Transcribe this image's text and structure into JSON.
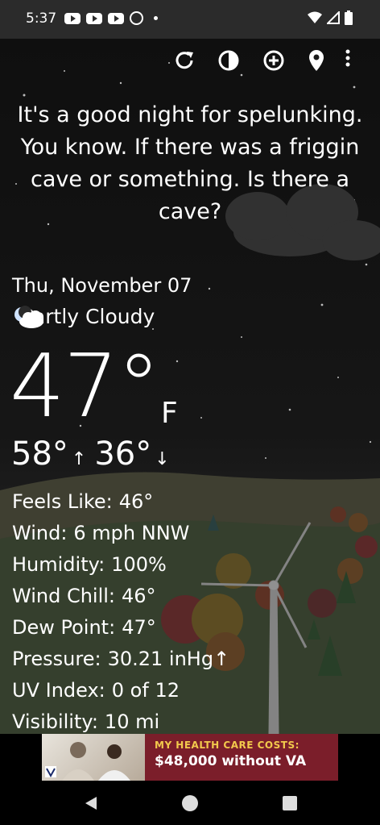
{
  "status_bar": {
    "time": "5:37",
    "left_icons": [
      "youtube-icon",
      "youtube-icon",
      "youtube-icon",
      "alarm-icon",
      "dot-icon"
    ],
    "right_icons": [
      "wifi-icon",
      "signal-icon",
      "battery-icon"
    ]
  },
  "toolbar": {
    "icons": [
      "refresh-icon",
      "theme-icon",
      "add-location-icon",
      "location-pin-icon",
      "more-icon"
    ]
  },
  "quote": "It's a good night for spelunking. You know. If there was a friggin cave or something. Is there a cave?",
  "weather": {
    "date": "Thu, November 07",
    "condition": "Partly Cloudy",
    "condition_icon": "partly-cloudy-night-icon",
    "temperature": "47°",
    "unit": "F",
    "high": "58°",
    "low": "36°"
  },
  "details": [
    {
      "label": "Feels Like:",
      "value": "46°"
    },
    {
      "label": "Wind:",
      "value": "6 mph NNW"
    },
    {
      "label": "Humidity:",
      "value": "100%"
    },
    {
      "label": "Wind Chill:",
      "value": "46°"
    },
    {
      "label": "Dew Point:",
      "value": "47°"
    },
    {
      "label": "Pressure:",
      "value": "30.21 inHg↑"
    },
    {
      "label": "UV Index:",
      "value": "0 of 12"
    },
    {
      "label": "Visibility:",
      "value": "10 mi"
    }
  ],
  "ad": {
    "line1": "MY HEALTH CARE COSTS:",
    "line2": "$48,000 without VA",
    "accent": "#7b1e2a"
  },
  "navbar": {
    "icons": [
      "back-icon",
      "home-icon",
      "recents-icon"
    ]
  }
}
